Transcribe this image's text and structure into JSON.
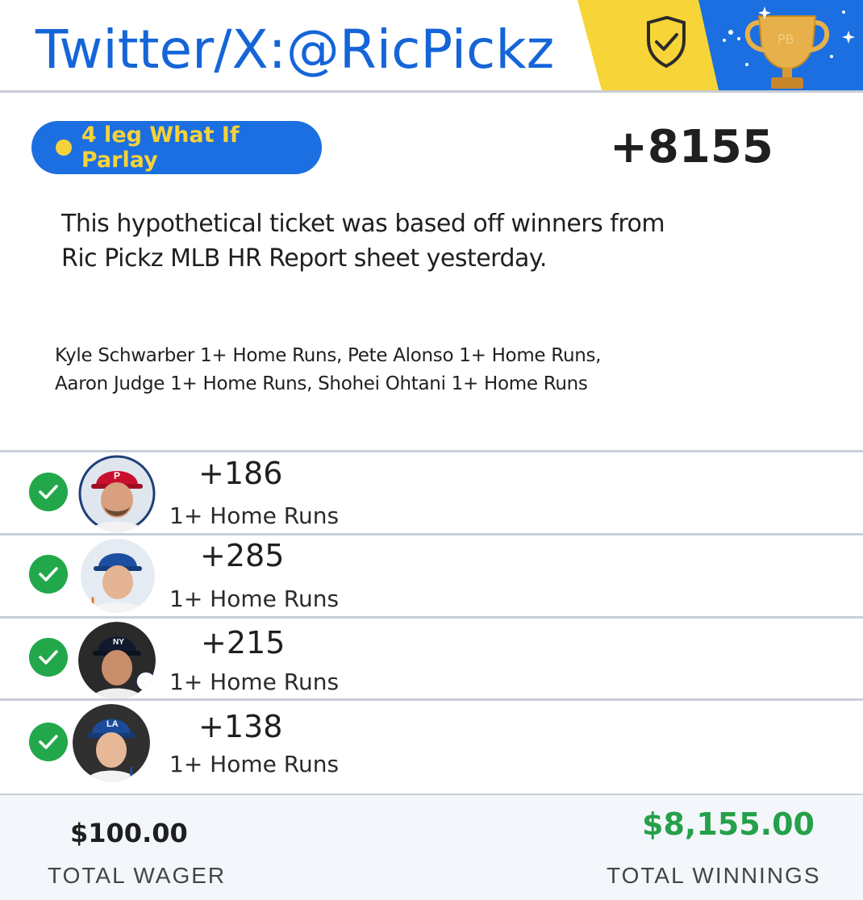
{
  "header": {
    "title": "Twitter/X:@RicPickz"
  },
  "parlay": {
    "label": "4 leg What If Parlay",
    "total_odds": "+8155"
  },
  "description": "This hypothetical ticket was based off winners from Ric Pickz MLB HR Report sheet yesterday.",
  "legs_summary": {
    "line1": "Kyle Schwarber 1+ Home Runs, Pete Alonso 1+ Home Runs,",
    "line2": "Aaron Judge 1+ Home Runs,  Shohei Ohtani 1+ Home Runs"
  },
  "legs": [
    {
      "odds": "+186",
      "market": "1+ Home Runs",
      "status": "won",
      "cap_color": "#c8102e",
      "team_icon": "phillies-logo-icon"
    },
    {
      "odds": "+285",
      "market": "1+ Home Runs",
      "status": "won",
      "cap_color": "#1d4fa0",
      "team_icon": "mets-logo-icon"
    },
    {
      "odds": "+215",
      "market": "1+ Home Runs",
      "status": "won",
      "cap_color": "#101a2c",
      "team_icon": "yankees-logo-icon"
    },
    {
      "odds": "+138",
      "market": "1+ Home Runs",
      "status": "won",
      "cap_color": "#1a4c9a",
      "team_icon": "dodgers-logo-icon"
    }
  ],
  "footer": {
    "wager_amount": "$100.00",
    "wager_label": "TOTAL WAGER",
    "winnings_amount": "$8,155.00",
    "winnings_label": "TOTAL WINNINGS"
  },
  "colors": {
    "brand_blue": "#1565d8",
    "pill_blue": "#1b6fe0",
    "pill_yellow": "#f6d23a",
    "success_green": "#22a84b",
    "winnings_green": "#26a04a"
  }
}
